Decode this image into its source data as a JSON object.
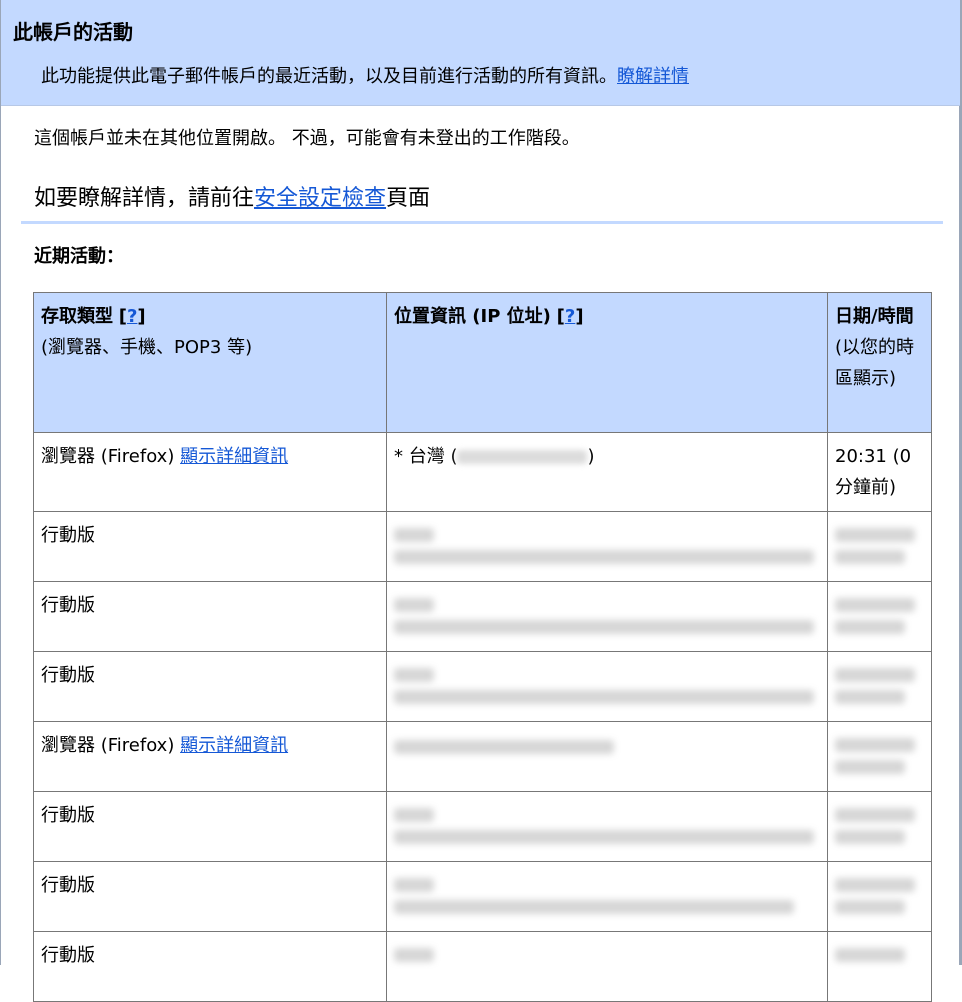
{
  "header": {
    "title": "此帳戶的活動",
    "description": "此功能提供此電子郵件帳戶的最近活動，以及目前進行活動的所有資訊。",
    "learn_more": "瞭解詳情"
  },
  "status": {
    "not_open_elsewhere": "這個帳戶並未在其他位置開啟。 不過，可能會有未登出的工作階段。",
    "security_prefix": "如要瞭解詳情，請前往",
    "security_link": "安全設定檢查",
    "security_suffix": "頁面"
  },
  "recent": {
    "label": "近期活動："
  },
  "table": {
    "headers": {
      "access_type": "存取類型",
      "access_help": "?",
      "access_sub": "(瀏覽器、手機、POP3 等)",
      "location": "位置資訊 (IP 位址)",
      "location_help": "?",
      "datetime": "日期/時間",
      "datetime_sub": "(以您的時區顯示)"
    },
    "rows": [
      {
        "access": "瀏覽器 (Firefox)",
        "details_link": "顯示詳細資訊",
        "location_prefix": "* 台灣 (",
        "location_suffix": ")",
        "time": "20:31 (0 分鐘前)",
        "blurred": false
      },
      {
        "access": "行動版",
        "details_link": "",
        "blurred": true
      },
      {
        "access": "行動版",
        "details_link": "",
        "blurred": true
      },
      {
        "access": "行動版",
        "details_link": "",
        "blurred": true
      },
      {
        "access": "瀏覽器 (Firefox)",
        "details_link": "顯示詳細資訊",
        "blurred": true
      },
      {
        "access": "行動版",
        "details_link": "",
        "blurred": true
      },
      {
        "access": "行動版",
        "details_link": "",
        "blurred": true
      },
      {
        "access": "行動版",
        "details_link": "",
        "blurred": true
      }
    ]
  },
  "colors": {
    "header_bg": "#c3d9ff",
    "link": "#1558d6"
  }
}
